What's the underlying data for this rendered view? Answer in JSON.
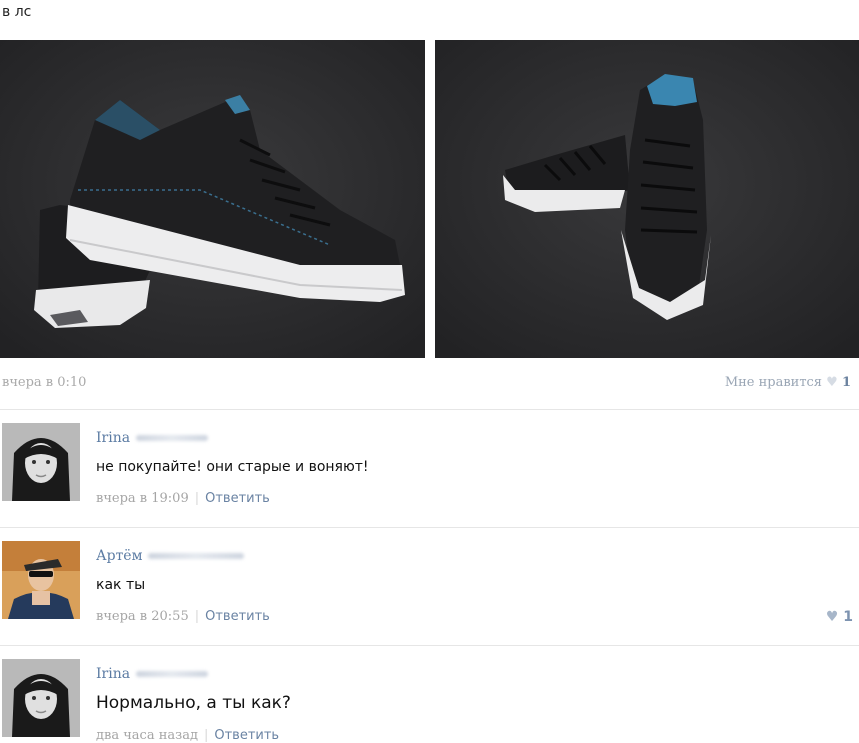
{
  "post": {
    "text": "в лс",
    "timestamp": "вчера в 0:10",
    "like_label": "Мне нравится",
    "like_icon": "heart-icon",
    "like_count": "1"
  },
  "comments": [
    {
      "author": "Irina",
      "text": "не покупайте! они старые и воняют!",
      "timestamp": "вчера в 19:09",
      "reply": "Ответить"
    },
    {
      "author": "Артём",
      "text": "как ты",
      "timestamp": "вчера в 20:55",
      "reply": "Ответить",
      "like_count": "1"
    },
    {
      "author": "Irina",
      "text": "Нормально, а ты как?",
      "timestamp": "два часа назад",
      "reply": "Ответить"
    }
  ],
  "colors": {
    "link": "#5b7ba3",
    "reply": "#6a83a3",
    "meta": "#a9a9a9"
  }
}
